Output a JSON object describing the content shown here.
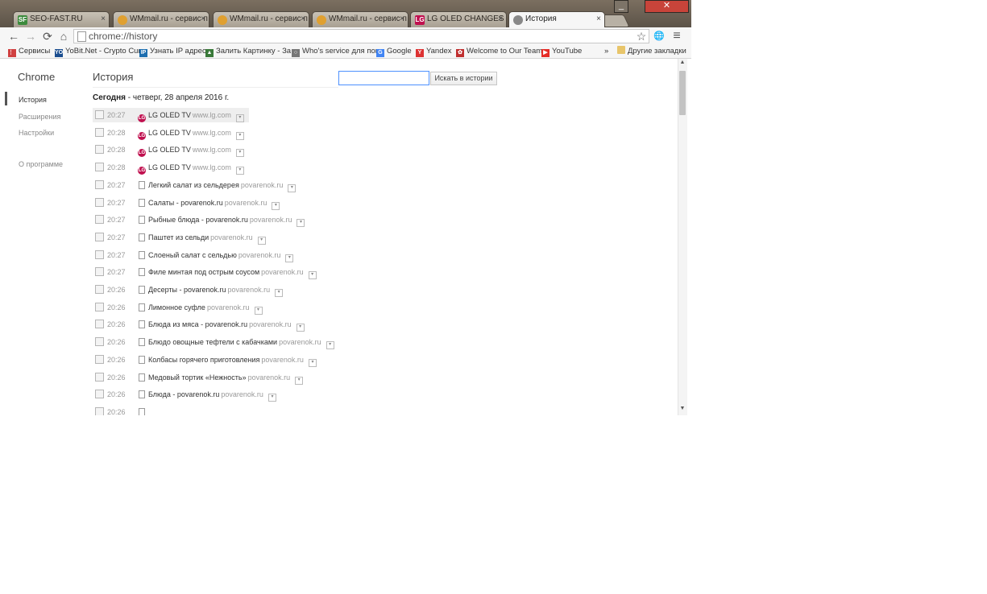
{
  "tabs": [
    {
      "title": "SEO-FAST.RU",
      "icon": "seofast-icon",
      "icon_text": "SF",
      "icon_color": "#3c8a3c"
    },
    {
      "title": "WMmail.ru - сервис п",
      "icon": "wmmail-icon",
      "icon_text": "",
      "icon_color": "#e0a030"
    },
    {
      "title": "WMmail.ru - сервис п",
      "icon": "wmmail-icon",
      "icon_text": "",
      "icon_color": "#e0a030"
    },
    {
      "title": "WMmail.ru - сервис п",
      "icon": "wmmail-icon",
      "icon_text": "",
      "icon_color": "#e0a030"
    },
    {
      "title": "LG OLED CHANGES E",
      "icon": "lg-icon",
      "icon_text": "LG",
      "icon_color": "#c0104f"
    },
    {
      "title": "История",
      "icon": "history-icon",
      "icon_text": "",
      "icon_color": "#888888",
      "active": true
    }
  ],
  "toolbar": {
    "url": "chrome://history",
    "back": "←",
    "forward": "→",
    "reload": "⟳",
    "home": "⌂",
    "star": "☆",
    "globe": "🌐",
    "menu": "≡"
  },
  "window_controls": {
    "minimize": "_",
    "close": "✕"
  },
  "bookmarks": [
    {
      "label": "Сервисы",
      "icon": "apps-icon",
      "icon_text": "⋮⋮",
      "color": "#d04040"
    },
    {
      "label": "YoBit.Net - Crypto Curr",
      "icon": "yobit-icon",
      "icon_text": "YO",
      "color": "#1a4d8f"
    },
    {
      "label": "Узнать IP адрес",
      "icon": "ip-icon",
      "icon_text": "IP",
      "color": "#1e6fb0"
    },
    {
      "label": "Залить Картинку - За",
      "icon": "image-icon",
      "icon_text": "▲",
      "color": "#3a7a3a"
    },
    {
      "label": "Who's service для пок",
      "icon": "search-icon",
      "icon_text": "○",
      "color": "#777777"
    },
    {
      "label": "Google",
      "icon": "google-icon",
      "icon_text": "G",
      "color": "#4285f4"
    },
    {
      "label": "Yandex",
      "icon": "yandex-icon",
      "icon_text": "Y",
      "color": "#d33"
    },
    {
      "label": "Welcome to Our Team",
      "icon": "welcome-icon",
      "icon_text": "✿",
      "color": "#c03030"
    },
    {
      "label": "YouTube",
      "icon": "youtube-icon",
      "icon_text": "▶",
      "color": "#e52d27"
    }
  ],
  "bookmarks_more": "»",
  "other_bookmarks": "Другие закладки",
  "sidebar": {
    "brand": "Chrome",
    "items": [
      {
        "label": "История",
        "active": true
      },
      {
        "label": "Расширения"
      },
      {
        "label": "Настройки"
      },
      {
        "label": "О программе"
      }
    ]
  },
  "history": {
    "title": "История",
    "search_button": "Искать в истории",
    "search_value": "",
    "date_label": "Сегодня",
    "date_rest": " - четверг, 28 апреля 2016 г.",
    "entries": [
      {
        "time": "20:27",
        "title": "LG OLED TV",
        "domain": "www.lg.com",
        "icon": "lg"
      },
      {
        "time": "20:28",
        "title": "LG OLED TV",
        "domain": "www.lg.com",
        "icon": "lg"
      },
      {
        "time": "20:28",
        "title": "LG OLED TV",
        "domain": "www.lg.com",
        "icon": "lg"
      },
      {
        "time": "20:28",
        "title": "LG OLED TV",
        "domain": "www.lg.com",
        "icon": "lg"
      },
      {
        "time": "20:27",
        "title": "Легкий салат из сельдерея",
        "domain": "povarenok.ru",
        "icon": "page"
      },
      {
        "time": "20:27",
        "title": "Салаты - povarenok.ru",
        "domain": "povarenok.ru",
        "icon": "page"
      },
      {
        "time": "20:27",
        "title": "Рыбные блюда - povarenok.ru",
        "domain": "povarenok.ru",
        "icon": "page"
      },
      {
        "time": "20:27",
        "title": "Паштет из сельди",
        "domain": "povarenok.ru",
        "icon": "page"
      },
      {
        "time": "20:27",
        "title": "Слоеный салат с сельдью",
        "domain": "povarenok.ru",
        "icon": "page"
      },
      {
        "time": "20:27",
        "title": "Филе минтая под острым соусом",
        "domain": "povarenok.ru",
        "icon": "page"
      },
      {
        "time": "20:26",
        "title": "Десерты - povarenok.ru",
        "domain": "povarenok.ru",
        "icon": "page"
      },
      {
        "time": "20:26",
        "title": "Лимонное суфле",
        "domain": "povarenok.ru",
        "icon": "page"
      },
      {
        "time": "20:26",
        "title": "Блюда из мяса - povarenok.ru",
        "domain": "povarenok.ru",
        "icon": "page"
      },
      {
        "time": "20:26",
        "title": "Блюдо овощные тефтели с кабачками",
        "domain": "povarenok.ru",
        "icon": "page"
      },
      {
        "time": "20:26",
        "title": "Колбасы горячего приготовления",
        "domain": "povarenok.ru",
        "icon": "page"
      },
      {
        "time": "20:26",
        "title": "Медовый тортик «Нежность»",
        "domain": "povarenok.ru",
        "icon": "page"
      },
      {
        "time": "20:26",
        "title": "Блюда - povarenok.ru",
        "domain": "povarenok.ru",
        "icon": "page"
      },
      {
        "time": "20:26",
        "title": "",
        "domain": "",
        "icon": "page"
      }
    ]
  }
}
